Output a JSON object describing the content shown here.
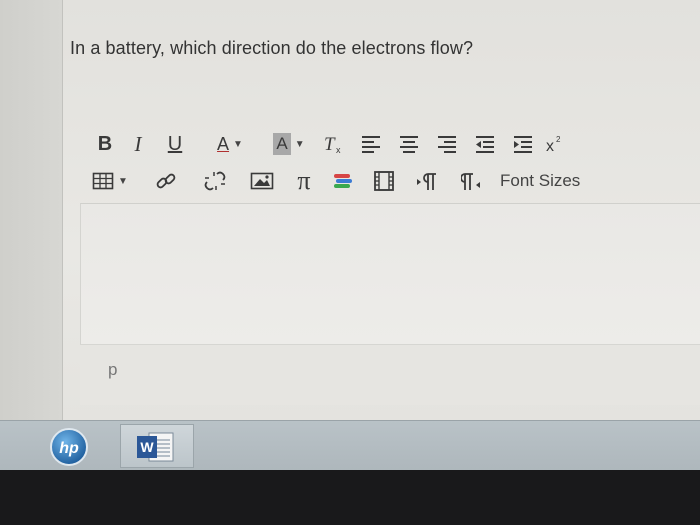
{
  "question": {
    "text": "In a battery, which direction do the electrons flow?"
  },
  "toolbar": {
    "bold_label": "B",
    "italic_label": "I",
    "underline_label": "U",
    "font_color_label": "A",
    "background_color_label": "A",
    "font_sizes_label": "Font Sizes",
    "icons": [
      "bold-icon",
      "italic-icon",
      "underline-icon",
      "font-color-icon",
      "background-color-icon",
      "clear-formatting-icon",
      "align-left-icon",
      "align-center-icon",
      "align-right-icon",
      "outdent-icon",
      "indent-icon",
      "superscript-icon",
      "table-icon",
      "link-icon",
      "unlink-icon",
      "image-icon",
      "pi-math-icon",
      "books-icon",
      "media-film-icon",
      "paragraph-ltr-icon",
      "paragraph-rtl-icon"
    ],
    "pi_symbol": "π"
  },
  "editor": {
    "path_label": "p"
  },
  "taskbar": {
    "items": [
      "hp-logo-icon",
      "word-icon"
    ],
    "hp_text": "hp",
    "word_letter": "W"
  },
  "colors": {
    "font_color_underline": "#b03030",
    "background_highlight": "#a8a8a8",
    "book_colors": [
      "#d64545",
      "#3b7bd4",
      "#3aa84f"
    ]
  }
}
